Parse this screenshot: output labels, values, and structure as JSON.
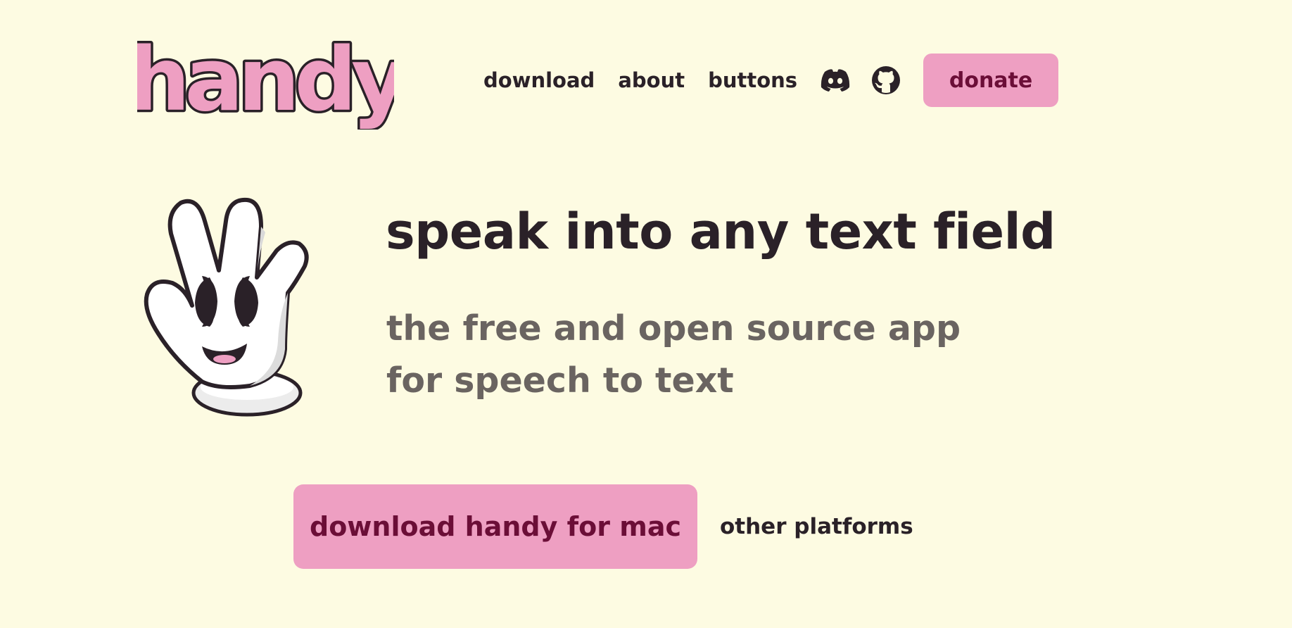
{
  "header": {
    "logo_text": "handy",
    "nav": [
      {
        "label": "download"
      },
      {
        "label": "about"
      },
      {
        "label": "buttons"
      }
    ],
    "icons": [
      "discord-icon",
      "github-icon"
    ],
    "donate_label": "donate"
  },
  "hero": {
    "headline": "speak into any text field",
    "subtitle": "the free and open source app for speech to text"
  },
  "cta": {
    "primary_label": "download handy for mac",
    "secondary_label": "other platforms"
  },
  "colors": {
    "background": "#fdfbe2",
    "accent": "#ee9fc2",
    "accent_text": "#6b0e37",
    "text": "#2a2128",
    "muted_text": "#6a6461"
  }
}
